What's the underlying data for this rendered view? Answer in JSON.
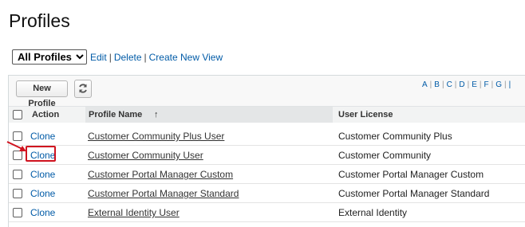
{
  "page": {
    "title": "Profiles"
  },
  "view_bar": {
    "selected_view": "All Profiles",
    "links": [
      "Edit",
      "Delete",
      "Create New View"
    ]
  },
  "toolbar": {
    "new_profile_label": "New Profile",
    "refresh_icon": "refresh-icon",
    "alphabet": [
      "A",
      "B",
      "C",
      "D",
      "E",
      "F",
      "G",
      "|"
    ]
  },
  "table": {
    "headers": {
      "action": "Action",
      "profile_name": "Profile Name",
      "sort_indicator": "↑",
      "user_license": "User License"
    },
    "rows": [
      {
        "action": "Clone",
        "profile_name": "Customer Community Plus User",
        "user_license": "Customer Community Plus"
      },
      {
        "action": "Clone",
        "profile_name": "Customer Community User",
        "user_license": "Customer Community"
      },
      {
        "action": "Clone",
        "profile_name": "Customer Portal Manager Custom",
        "user_license": "Customer Portal Manager Custom"
      },
      {
        "action": "Clone",
        "profile_name": "Customer Portal Manager Standard",
        "user_license": "Customer Portal Manager Standard"
      },
      {
        "action": "Clone",
        "profile_name": "External Identity User",
        "user_license": "External Identity"
      }
    ]
  },
  "annotation": {
    "color": "#d0131f",
    "target": "Clone"
  },
  "colors": {
    "link": "#015ba7",
    "header_bg": "#f2f3f3",
    "sorted_header_bg": "#e4e6e7"
  }
}
